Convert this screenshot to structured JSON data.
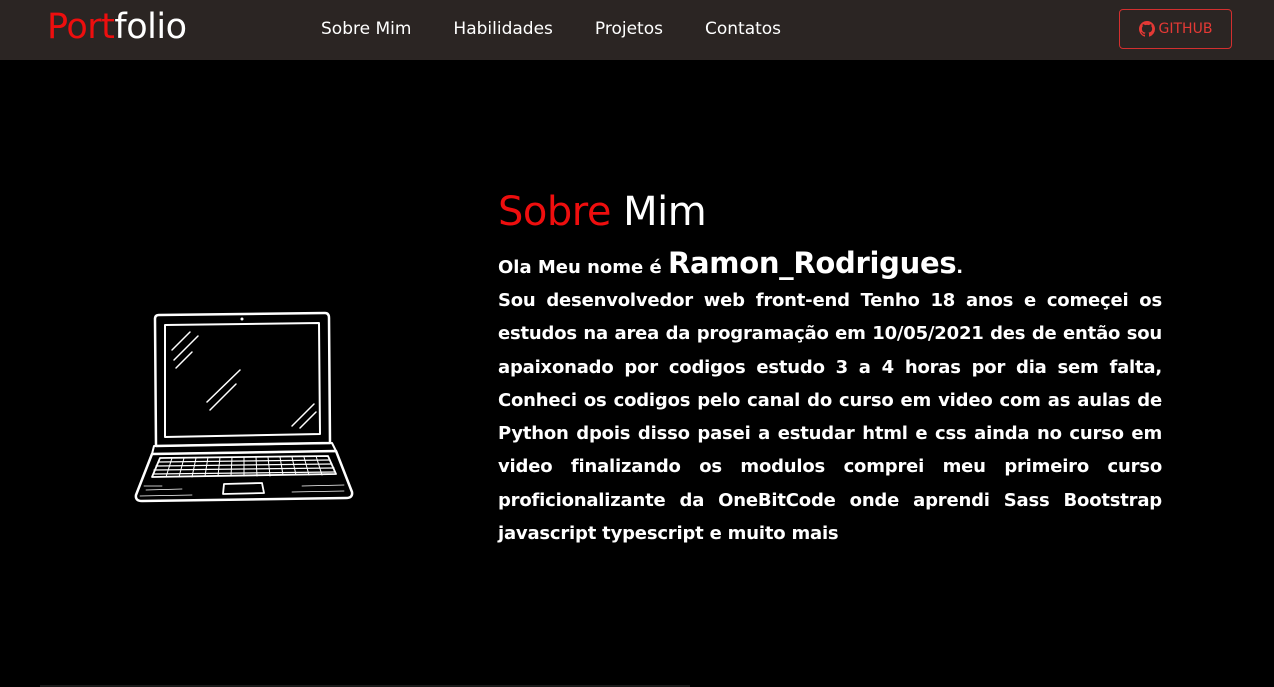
{
  "brand": {
    "part1": "Port",
    "part2": "folio"
  },
  "nav": [
    {
      "label": "Sobre Mim"
    },
    {
      "label": "Habilidades"
    },
    {
      "label": "Projetos"
    },
    {
      "label": "Contatos"
    }
  ],
  "github": {
    "label": "GITHUB",
    "icon": "github-icon"
  },
  "about": {
    "title_part1": "Sobre",
    "title_part2": "Mim",
    "intro_prefix": "Ola Meu nome é",
    "name": "Ramon_Rodrigues",
    "intro_suffix": ".",
    "bio": "Sou desenvolvedor web front-end Tenho 18 anos e começei os estudos na area da programação em 10/05/2021 des de então sou apaixonado por codigos estudo 3 a 4 horas por dia sem falta, Conheci os codigos pelo canal do curso em video com as aulas de Python dpois disso pasei a estudar html e css ainda no curso em video finalizando os modulos comprei meu primeiro curso proficionalizante da OneBitCode onde aprendi Sass Bootstrap javascript typescript e muito mais"
  },
  "colors": {
    "accent": "#ee0e0e",
    "navbar": "#2b2523",
    "background": "#000000"
  }
}
